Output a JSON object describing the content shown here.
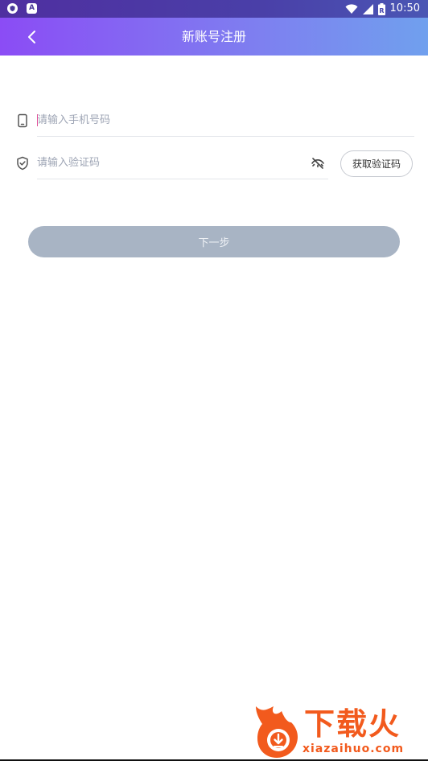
{
  "status_bar": {
    "left_badges": [
      "shield-badge",
      "a-badge"
    ],
    "badge_a_text": "A",
    "icons": [
      "wifi-icon",
      "signal-icon",
      "battery-icon"
    ],
    "battery_badge": "R",
    "time": "10:50"
  },
  "header": {
    "title": "新账号注册",
    "back_icon": "chevron-left-icon"
  },
  "form": {
    "phone": {
      "icon": "phone-icon",
      "placeholder": "请输入手机号码",
      "value": ""
    },
    "code": {
      "icon": "shield-check-icon",
      "placeholder": "请输入验证码",
      "value": "",
      "visibility_icon": "eye-off-icon"
    },
    "get_code_label": "获取验证码",
    "next_label": "下一步"
  },
  "watermark": {
    "brand": "下载火",
    "site": "xiazaihuo.com"
  },
  "colors": {
    "header_gradient_start": "#8b4cf5",
    "header_gradient_end": "#70a0ee",
    "next_button_disabled": "#a8b4c4",
    "caret": "#e0509a",
    "watermark": "#f25a1d"
  }
}
